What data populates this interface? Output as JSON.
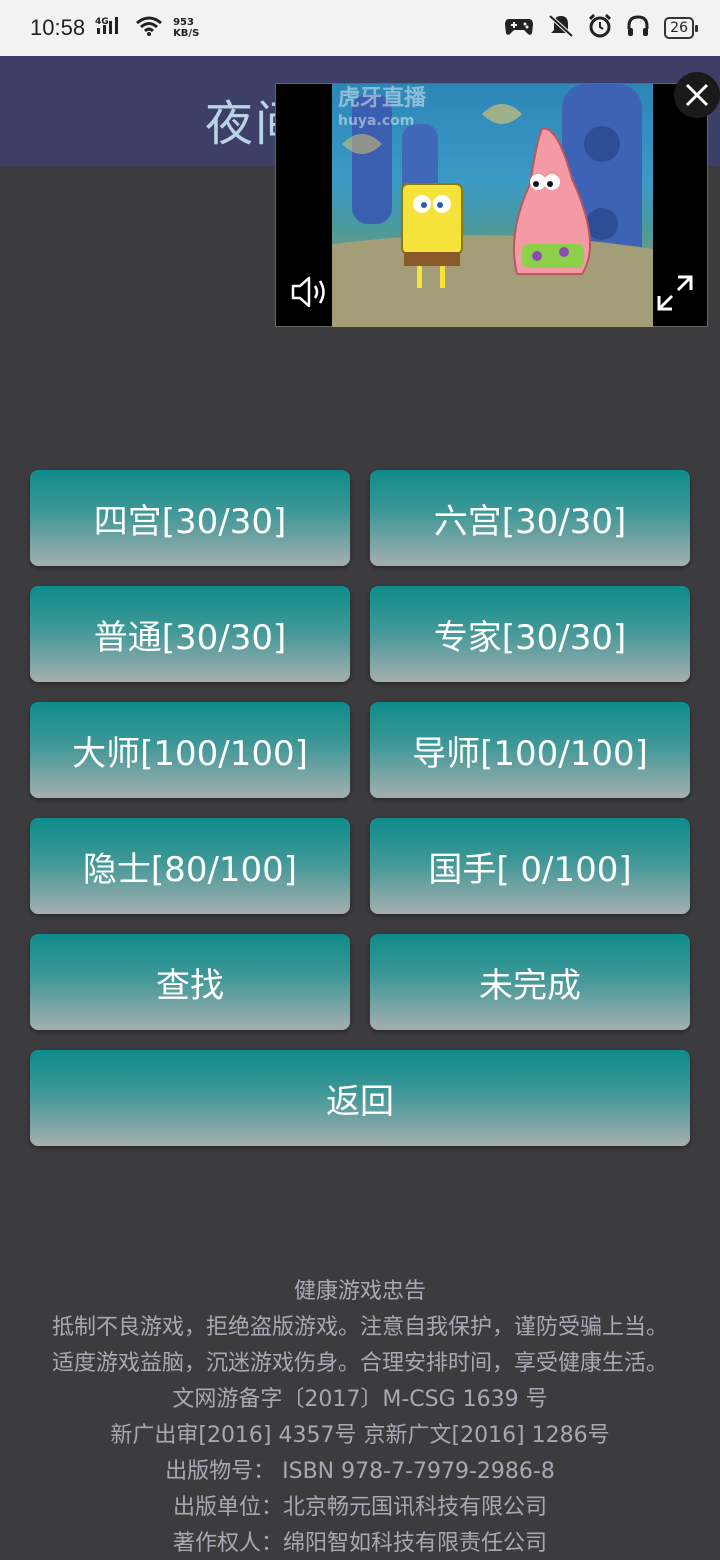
{
  "status_bar": {
    "time": "10:58",
    "net_speed_value": "953",
    "net_speed_unit": "KB/S",
    "network": "4G",
    "battery": "26"
  },
  "header": {
    "title": "夜间"
  },
  "video": {
    "watermark_title": "虎牙直播",
    "watermark_sub": "huya.com"
  },
  "buttons": {
    "four_grid": "四宫[30/30]",
    "six_grid": "六宫[30/30]",
    "normal": "普通[30/30]",
    "expert": "专家[30/30]",
    "grandmaster": "大师[100/100]",
    "mentor": "导师[100/100]",
    "hermit": "隐士[80/100]",
    "national": "国手[ 0/100]",
    "search": "查找",
    "unfinished": "未完成",
    "back": "返回"
  },
  "footer": {
    "lines": [
      "健康游戏忠告",
      "抵制不良游戏，拒绝盗版游戏。注意自我保护，谨防受骗上当。",
      "适度游戏益脑，沉迷游戏伤身。合理安排时间，享受健康生活。",
      "文网游备字〔2017〕M-CSG 1639 号",
      "新广出审[2016] 4357号 京新广文[2016] 1286号",
      "出版物号： ISBN 978-7-7979-2986-8",
      "出版单位：北京畅元国讯科技有限公司",
      "著作权人：绵阳智如科技有限责任公司"
    ]
  }
}
